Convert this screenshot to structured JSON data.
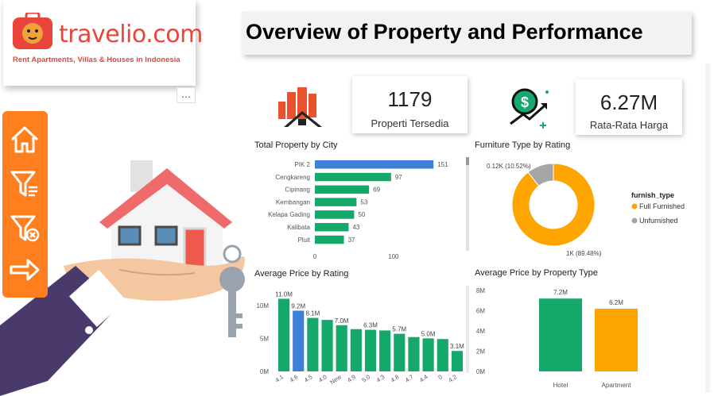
{
  "logo": {
    "brand": "travelio.com",
    "tagline": "Rent Apartments, Villas & Houses in Indonesia"
  },
  "more_label": "...",
  "title": "Overview of Property and Performance",
  "sidebar": {
    "items": [
      {
        "icon": "home-icon"
      },
      {
        "icon": "filter-icon"
      },
      {
        "icon": "clear-filter-icon"
      },
      {
        "icon": "arrow-right-icon"
      }
    ]
  },
  "kpi": {
    "properties": {
      "value": "1179",
      "label": "Properti Tersedia",
      "icon": "building-icon"
    },
    "price": {
      "value": "6.27M",
      "label": "Rata-Rata Harga",
      "icon": "money-growth-icon"
    }
  },
  "colors": {
    "green": "#14a86a",
    "blue": "#3d7fd9",
    "orange": "#ffa500",
    "gray": "#a6a6a6",
    "accent": "#ff7f1e"
  },
  "chart_data": [
    {
      "id": "city",
      "type": "bar",
      "orientation": "horizontal",
      "title": "Total Property by City",
      "categories": [
        "PIK 2",
        "Cengkareng",
        "Cipinang",
        "Kembangan",
        "Kelapa Gading",
        "Kalibata",
        "Pluit"
      ],
      "values": [
        151,
        97,
        69,
        53,
        50,
        43,
        37
      ],
      "x_ticks": [
        "0",
        "100"
      ],
      "xlim": [
        0,
        170
      ],
      "highlight_index": 0
    },
    {
      "id": "furniture",
      "type": "pie",
      "style": "donut",
      "title": "Furniture Type by Rating",
      "legend_title": "furnish_type",
      "legend_position": "right",
      "slices": [
        {
          "name": "Full Furnished",
          "value": 1054.6,
          "label": "1K (89.48%)"
        },
        {
          "name": "Unfurnished",
          "value": 124.0,
          "label": "0.12K (10.52%)"
        }
      ]
    },
    {
      "id": "rating",
      "type": "bar",
      "title": "Average Price by Rating",
      "categories": [
        "4.1",
        "4.6",
        "4.5",
        "4.0",
        "New",
        "4.9",
        "5.0",
        "4.3",
        "4.8",
        "4.7",
        "4.4",
        "0",
        "4.2"
      ],
      "values": [
        11.0,
        9.2,
        8.1,
        7.8,
        7.0,
        6.4,
        6.3,
        6.2,
        5.7,
        5.2,
        5.0,
        4.9,
        3.1
      ],
      "data_labels": [
        "11.0M",
        "9.2M",
        "8.1M",
        "",
        "7.0M",
        "",
        "6.3M",
        "",
        "5.7M",
        "",
        "5.0M",
        "",
        "3.1M"
      ],
      "y_ticks": [
        "0M",
        "5M",
        "10M"
      ],
      "ylim": [
        0,
        12.5
      ],
      "highlight_index": 1
    },
    {
      "id": "type",
      "type": "bar",
      "title": "Average Price by Property Type",
      "categories": [
        "Hotel",
        "Apartment"
      ],
      "values": [
        7.2,
        6.2
      ],
      "data_labels": [
        "7.2M",
        "6.2M"
      ],
      "y_ticks": [
        "0M",
        "2M",
        "4M",
        "6M",
        "8M"
      ],
      "ylim": [
        0,
        8
      ]
    }
  ]
}
